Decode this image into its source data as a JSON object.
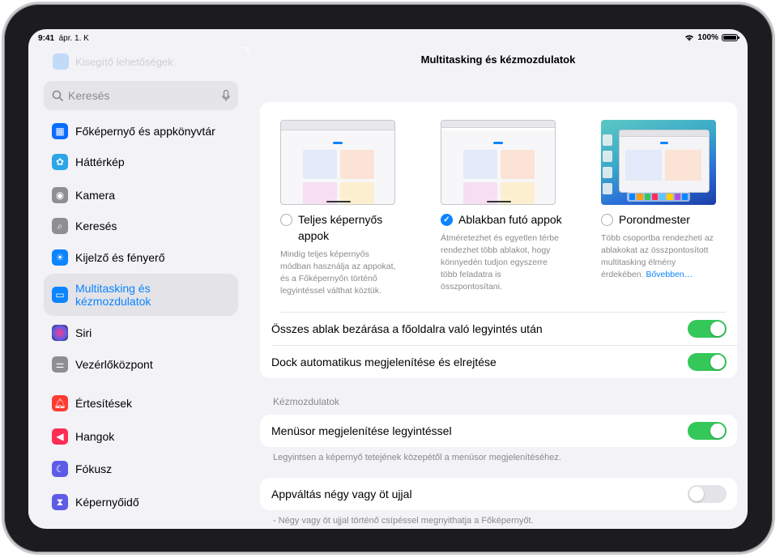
{
  "status": {
    "time": "9:41",
    "date": "ápr. 1. K",
    "battery": "100%"
  },
  "sidebar": {
    "faded_item": "Kisegítő lehetőségek",
    "search_placeholder": "Keresés",
    "items": [
      {
        "label": "Főképernyő és appkönyvtár",
        "icon": "grid-icon",
        "color": "#0a6cff"
      },
      {
        "label": "Háttérkép",
        "icon": "flower-icon",
        "color": "#2aa5e8"
      },
      {
        "label": "Kamera",
        "icon": "camera-icon",
        "color": "#8e8e93"
      },
      {
        "label": "Keresés",
        "icon": "search-icon",
        "color": "#8e8e93"
      },
      {
        "label": "Kijelző és fényerő",
        "icon": "sun-icon",
        "color": "#0a84ff"
      },
      {
        "label": "Multitasking és kézmozdulatok",
        "icon": "multitasking-icon",
        "color": "#0a84ff",
        "selected": true
      },
      {
        "label": "Siri",
        "icon": "siri-icon",
        "color": "#3a3a3c"
      },
      {
        "label": "Vezérlőközpont",
        "icon": "toggles-icon",
        "color": "#8e8e93"
      },
      {
        "label": "Értesítések",
        "icon": "bell-icon",
        "color": "#ff3b30"
      },
      {
        "label": "Hangok",
        "icon": "speaker-icon",
        "color": "#ff2d55"
      },
      {
        "label": "Fókusz",
        "icon": "moon-icon",
        "color": "#5e5ce6"
      },
      {
        "label": "Képernyőidő",
        "icon": "hourglass-icon",
        "color": "#5e5ce6"
      }
    ]
  },
  "main": {
    "title": "Multitasking és kézmozdulatok",
    "modes": [
      {
        "label": "Teljes képernyős appok",
        "selected": false,
        "description": "Mindig teljes képernyős módban használja az appokat, és a Főképernyőn történő legyintéssel válthat köztük."
      },
      {
        "label": "Ablakban futó appok",
        "selected": true,
        "description": "Átméretezhet és egyetlen térbe rendezhet több ablakot, hogy könnyedén tudjon egyszerre több feladatra is összpontosítani."
      },
      {
        "label": "Porondmester",
        "selected": false,
        "description": "Több csoportba rendezheti az ablakokat az összpontosított multitasking élmény érdekében.",
        "link": "Bővebben…"
      }
    ],
    "toggles": [
      {
        "label": "Összes ablak bezárása a főoldalra való legyintés után",
        "on": true
      },
      {
        "label": "Dock automatikus megjelenítése és elrejtése",
        "on": true
      }
    ],
    "gestures_header": "Kézmozdulatok",
    "menu_toggle": {
      "label": "Menüsor megjelenítése legyintéssel",
      "on": true
    },
    "menu_footnote": "Legyintsen a képernyő tetejének közepétől a menüsor megjelenítéséhez.",
    "appswitch_toggle": {
      "label": "Appváltás négy vagy öt ujjal",
      "on": false
    },
    "appswitch_footnote": "- Négy vagy öt ujjal történő csípéssel megnyithatja a Főképernyőt."
  }
}
